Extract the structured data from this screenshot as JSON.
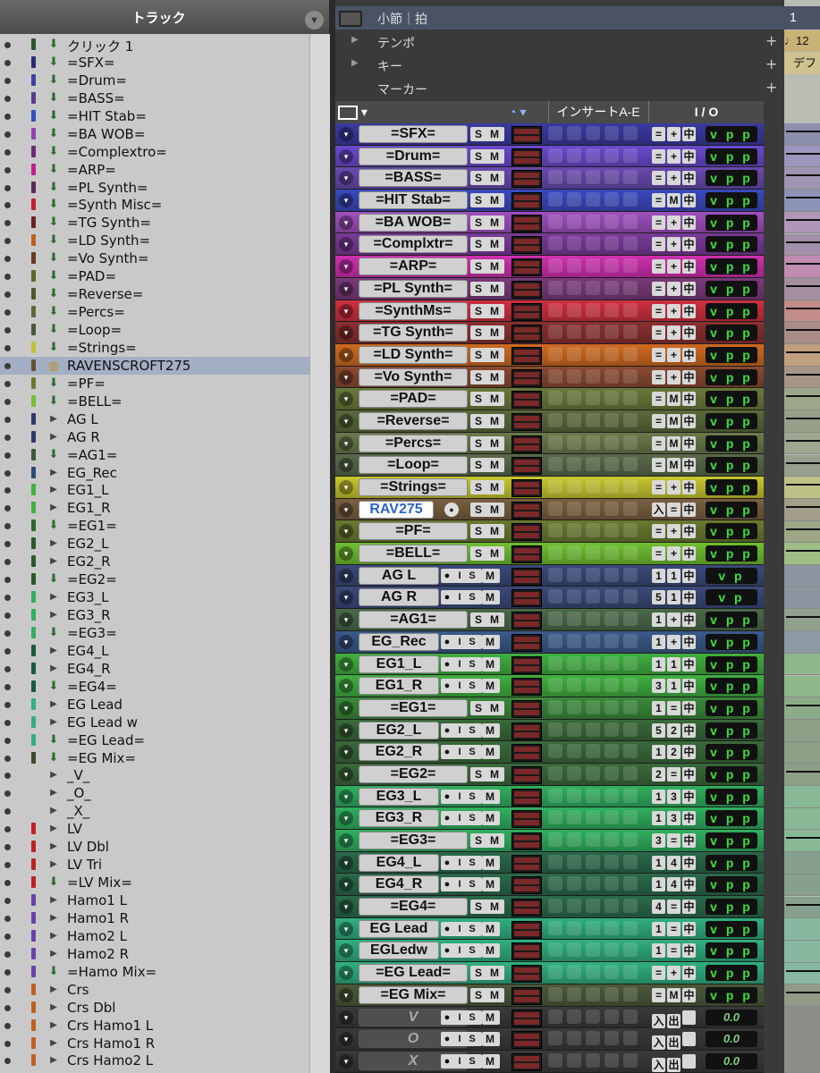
{
  "track_list": {
    "title": "トラック",
    "rows": [
      {
        "name": "クリック 1",
        "color": "#2b5a2b",
        "icon": "arrow",
        "selected": false
      },
      {
        "name": "=SFX=",
        "color": "#2b2b7a",
        "icon": "arrow",
        "selected": false
      },
      {
        "name": "=Drum=",
        "color": "#4040a0",
        "icon": "arrow",
        "selected": false
      },
      {
        "name": "=BASS=",
        "color": "#5a3a8a",
        "icon": "arrow",
        "selected": false
      },
      {
        "name": "=HIT Stab=",
        "color": "#3050c0",
        "icon": "arrow",
        "selected": false
      },
      {
        "name": "=BA WOB=",
        "color": "#9040b0",
        "icon": "arrow",
        "selected": false
      },
      {
        "name": "=Complextro=",
        "color": "#6a2a7a",
        "icon": "arrow",
        "selected": false
      },
      {
        "name": "=ARP=",
        "color": "#c02090",
        "icon": "arrow",
        "selected": false
      },
      {
        "name": "=PL Synth=",
        "color": "#5a2a5a",
        "icon": "arrow",
        "selected": false
      },
      {
        "name": "=Synth Misc=",
        "color": "#c02030",
        "icon": "arrow",
        "selected": false
      },
      {
        "name": "=TG Synth=",
        "color": "#6a2020",
        "icon": "arrow",
        "selected": false
      },
      {
        "name": "=LD Synth=",
        "color": "#c06020",
        "icon": "arrow",
        "selected": false
      },
      {
        "name": "=Vo Synth=",
        "color": "#6a3a20",
        "icon": "arrow",
        "selected": false
      },
      {
        "name": "=PAD=",
        "color": "#5a6a2a",
        "icon": "arrow",
        "selected": false
      },
      {
        "name": "=Reverse=",
        "color": "#4a5a2a",
        "icon": "arrow",
        "selected": false
      },
      {
        "name": "=Percs=",
        "color": "#5a6a3a",
        "icon": "arrow",
        "selected": false
      },
      {
        "name": "=Loop=",
        "color": "#4a5a3a",
        "icon": "arrow",
        "selected": false
      },
      {
        "name": "=Strings=",
        "color": "#c0c030",
        "icon": "arrow",
        "selected": false
      },
      {
        "name": "RAVENSCROFT275",
        "color": "#6a5030",
        "icon": "midi",
        "selected": true
      },
      {
        "name": "=PF=",
        "color": "#6a7a2a",
        "icon": "arrow",
        "selected": false
      },
      {
        "name": "=BELL=",
        "color": "#70c030",
        "icon": "arrow",
        "selected": false
      },
      {
        "name": "AG L",
        "color": "#2a3a6a",
        "icon": "audio",
        "selected": false
      },
      {
        "name": "AG R",
        "color": "#2a3a6a",
        "icon": "audio",
        "selected": false
      },
      {
        "name": "=AG1=",
        "color": "#3a5a3a",
        "icon": "arrow",
        "selected": false
      },
      {
        "name": "EG_Rec",
        "color": "#2a4a7a",
        "icon": "audio",
        "selected": false
      },
      {
        "name": "EG1_L",
        "color": "#40b040",
        "icon": "audio",
        "selected": false
      },
      {
        "name": "EG1_R",
        "color": "#40b040",
        "icon": "audio",
        "selected": false
      },
      {
        "name": "=EG1=",
        "color": "#2a6a2a",
        "icon": "arrow",
        "selected": false
      },
      {
        "name": "EG2_L",
        "color": "#2a5a2a",
        "icon": "audio",
        "selected": false
      },
      {
        "name": "EG2_R",
        "color": "#2a5a2a",
        "icon": "audio",
        "selected": false
      },
      {
        "name": "=EG2=",
        "color": "#2a5a2a",
        "icon": "arrow",
        "selected": false
      },
      {
        "name": "EG3_L",
        "color": "#30b060",
        "icon": "audio",
        "selected": false
      },
      {
        "name": "EG3_R",
        "color": "#30b060",
        "icon": "audio",
        "selected": false
      },
      {
        "name": "=EG3=",
        "color": "#30b060",
        "icon": "arrow",
        "selected": false
      },
      {
        "name": "EG4_L",
        "color": "#1a5a3a",
        "icon": "audio",
        "selected": false
      },
      {
        "name": "EG4_R",
        "color": "#1a5a3a",
        "icon": "audio",
        "selected": false
      },
      {
        "name": "=EG4=",
        "color": "#1a5a3a",
        "icon": "arrow",
        "selected": false
      },
      {
        "name": "EG Lead",
        "color": "#30b080",
        "icon": "audio",
        "selected": false
      },
      {
        "name": "EG Lead w",
        "color": "#30b080",
        "icon": "audio",
        "selected": false
      },
      {
        "name": "=EG Lead=",
        "color": "#30b080",
        "icon": "arrow",
        "selected": false
      },
      {
        "name": "=EG Mix=",
        "color": "#3a4a2a",
        "icon": "arrow",
        "selected": false
      },
      {
        "name": "_V_",
        "color": "",
        "icon": "audio",
        "selected": false
      },
      {
        "name": "_O_",
        "color": "",
        "icon": "audio",
        "selected": false
      },
      {
        "name": "_X_",
        "color": "",
        "icon": "audio",
        "selected": false
      },
      {
        "name": "LV",
        "color": "#c02020",
        "icon": "audio",
        "selected": false
      },
      {
        "name": "LV Dbl",
        "color": "#c02020",
        "icon": "audio",
        "selected": false
      },
      {
        "name": "LV Tri",
        "color": "#c02020",
        "icon": "audio",
        "selected": false
      },
      {
        "name": "=LV Mix=",
        "color": "#c02020",
        "icon": "arrow",
        "selected": false
      },
      {
        "name": "Hamo1 L",
        "color": "#6a40b0",
        "icon": "audio",
        "selected": false
      },
      {
        "name": "Hamo1 R",
        "color": "#6a40b0",
        "icon": "audio",
        "selected": false
      },
      {
        "name": "Hamo2 L",
        "color": "#6a40b0",
        "icon": "audio",
        "selected": false
      },
      {
        "name": "Hamo2 R",
        "color": "#6a40b0",
        "icon": "audio",
        "selected": false
      },
      {
        "name": "=Hamo Mix=",
        "color": "#6a40b0",
        "icon": "arrow",
        "selected": false
      },
      {
        "name": "Crs",
        "color": "#c06020",
        "icon": "audio",
        "selected": false
      },
      {
        "name": "Crs Dbl",
        "color": "#c06020",
        "icon": "audio",
        "selected": false
      },
      {
        "name": "Crs Hamo1 L",
        "color": "#c06020",
        "icon": "audio",
        "selected": false
      },
      {
        "name": "Crs Hamo1 R",
        "color": "#c06020",
        "icon": "audio",
        "selected": false
      },
      {
        "name": "Crs Hamo2 L",
        "color": "#c06020",
        "icon": "audio",
        "selected": false
      }
    ]
  },
  "rulers": {
    "main": "小節｜拍",
    "tempo": "テンポ",
    "key": "キー",
    "marker": "マーカー"
  },
  "timeline": {
    "bar": "1",
    "tempo_value": "♩12",
    "key_value": "デフ"
  },
  "column_header": {
    "inserts": "インサートA-E",
    "io": "I / O"
  },
  "edit_tracks": [
    {
      "name": "=SFX=",
      "color": "#3a3aa0",
      "type": "aux",
      "io": [
        "=",
        "+",
        "中"
      ],
      "out": "v p p"
    },
    {
      "name": "=Drum=",
      "color": "#6a4ad0",
      "type": "aux",
      "io": [
        "=",
        "+",
        "中"
      ],
      "out": "v p p"
    },
    {
      "name": "=BASS=",
      "color": "#6a4ab0",
      "type": "aux",
      "io": [
        "=",
        "+",
        "中"
      ],
      "out": "v p p"
    },
    {
      "name": "=HIT Stab=",
      "color": "#3a4ac0",
      "type": "aux",
      "io": [
        "=",
        "M",
        "中"
      ],
      "out": "v p p"
    },
    {
      "name": "=BA WOB=",
      "color": "#a050c0",
      "type": "aux",
      "io": [
        "=",
        "+",
        "中"
      ],
      "out": "v p p"
    },
    {
      "name": "=Complxtr=",
      "color": "#7a3a9a",
      "type": "aux",
      "io": [
        "=",
        "+",
        "中"
      ],
      "out": "v p p"
    },
    {
      "name": "=ARP=",
      "color": "#d030b0",
      "type": "aux",
      "io": [
        "=",
        "+",
        "中"
      ],
      "out": "v p p"
    },
    {
      "name": "=PL Synth=",
      "color": "#7a3a7a",
      "type": "aux",
      "io": [
        "=",
        "+",
        "中"
      ],
      "out": "v p p"
    },
    {
      "name": "=SynthMs=",
      "color": "#d03040",
      "type": "aux",
      "io": [
        "=",
        "+",
        "中"
      ],
      "out": "v p p"
    },
    {
      "name": "=TG Synth=",
      "color": "#8a3030",
      "type": "aux",
      "io": [
        "=",
        "+",
        "中"
      ],
      "out": "v p p"
    },
    {
      "name": "=LD Synth=",
      "color": "#d06a20",
      "type": "aux",
      "io": [
        "=",
        "+",
        "中"
      ],
      "out": "v p p"
    },
    {
      "name": "=Vo Synth=",
      "color": "#8a4a30",
      "type": "aux",
      "io": [
        "=",
        "+",
        "中"
      ],
      "out": "v p p"
    },
    {
      "name": "=PAD=",
      "color": "#6a7a3a",
      "type": "aux",
      "io": [
        "=",
        "M",
        "中"
      ],
      "out": "v p p"
    },
    {
      "name": "=Reverse=",
      "color": "#5a6a3a",
      "type": "aux",
      "io": [
        "=",
        "M",
        "中"
      ],
      "out": "v p p"
    },
    {
      "name": "=Percs=",
      "color": "#6a7a4a",
      "type": "aux",
      "io": [
        "=",
        "M",
        "中"
      ],
      "out": "v p p"
    },
    {
      "name": "=Loop=",
      "color": "#5a6a4a",
      "type": "aux",
      "io": [
        "=",
        "M",
        "中"
      ],
      "out": "v p p"
    },
    {
      "name": "=Strings=",
      "color": "#c8c830",
      "type": "aux",
      "io": [
        "=",
        "+",
        "中"
      ],
      "out": "v p p"
    },
    {
      "name": "RAV275",
      "color": "#7a6040",
      "type": "inst",
      "io": [
        "入",
        "=",
        "中"
      ],
      "out": "v p p"
    },
    {
      "name": "=PF=",
      "color": "#6a7a30",
      "type": "aux",
      "io": [
        "=",
        "+",
        "中"
      ],
      "out": "v p p"
    },
    {
      "name": "=BELL=",
      "color": "#70c030",
      "type": "aux",
      "io": [
        "=",
        "+",
        "中"
      ],
      "out": "v p p"
    },
    {
      "name": "AG L",
      "color": "#3a4a7a",
      "type": "audio",
      "io": [
        "1",
        "1",
        "中"
      ],
      "out": "v p"
    },
    {
      "name": "AG R",
      "color": "#3a4a7a",
      "type": "audio",
      "io": [
        "5",
        "1",
        "中"
      ],
      "out": "v p"
    },
    {
      "name": "=AG1=",
      "color": "#4a6a4a",
      "type": "aux",
      "io": [
        "1",
        "+",
        "中"
      ],
      "out": "v p p"
    },
    {
      "name": "EG_Rec",
      "color": "#3a5a8a",
      "type": "audio",
      "io": [
        "1",
        "+",
        "中"
      ],
      "out": "v p p"
    },
    {
      "name": "EG1_L",
      "color": "#40b040",
      "type": "audio",
      "io": [
        "1",
        "1",
        "中"
      ],
      "out": "v p p"
    },
    {
      "name": "EG1_R",
      "color": "#40b040",
      "type": "audio",
      "io": [
        "3",
        "1",
        "中"
      ],
      "out": "v p p"
    },
    {
      "name": "=EG1=",
      "color": "#3a8a3a",
      "type": "aux",
      "io": [
        "1",
        "=",
        "中"
      ],
      "out": "v p p"
    },
    {
      "name": "EG2_L",
      "color": "#3a6a3a",
      "type": "audio",
      "io": [
        "5",
        "2",
        "中"
      ],
      "out": "v p p"
    },
    {
      "name": "EG2_R",
      "color": "#3a6a3a",
      "type": "audio",
      "io": [
        "1",
        "2",
        "中"
      ],
      "out": "v p p"
    },
    {
      "name": "=EG2=",
      "color": "#3a6a3a",
      "type": "aux",
      "io": [
        "2",
        "=",
        "中"
      ],
      "out": "v p p"
    },
    {
      "name": "EG3_L",
      "color": "#30b060",
      "type": "audio",
      "io": [
        "1",
        "3",
        "中"
      ],
      "out": "v p p"
    },
    {
      "name": "EG3_R",
      "color": "#30b060",
      "type": "audio",
      "io": [
        "1",
        "3",
        "中"
      ],
      "out": "v p p"
    },
    {
      "name": "=EG3=",
      "color": "#30b060",
      "type": "aux",
      "io": [
        "3",
        "=",
        "中"
      ],
      "out": "v p p"
    },
    {
      "name": "EG4_L",
      "color": "#2a6a4a",
      "type": "audio",
      "io": [
        "1",
        "4",
        "中"
      ],
      "out": "v p p"
    },
    {
      "name": "EG4_R",
      "color": "#2a6a4a",
      "type": "audio",
      "io": [
        "1",
        "4",
        "中"
      ],
      "out": "v p p"
    },
    {
      "name": "=EG4=",
      "color": "#2a6a4a",
      "type": "aux",
      "io": [
        "4",
        "=",
        "中"
      ],
      "out": "v p p"
    },
    {
      "name": "EG Lead",
      "color": "#30b080",
      "type": "audio",
      "io": [
        "1",
        "=",
        "中"
      ],
      "out": "v p p"
    },
    {
      "name": "EGLedw",
      "color": "#30b080",
      "type": "audio",
      "io": [
        "1",
        "=",
        "中"
      ],
      "out": "v p p"
    },
    {
      "name": "=EG Lead=",
      "color": "#30b080",
      "type": "aux",
      "io": [
        "=",
        "+",
        "中"
      ],
      "out": "v p p"
    },
    {
      "name": "=EG Mix=",
      "color": "#4a5a3a",
      "type": "aux",
      "io": [
        "=",
        "M",
        "中"
      ],
      "out": "v p p"
    },
    {
      "name": "V",
      "color": "#3a3a3a",
      "type": "inactive",
      "io": [
        "入",
        "出",
        ""
      ],
      "out": "0.0"
    },
    {
      "name": "O",
      "color": "#3a3a3a",
      "type": "inactive",
      "io": [
        "入",
        "出",
        ""
      ],
      "out": "0.0"
    },
    {
      "name": "X",
      "color": "#3a3a3a",
      "type": "inactive",
      "io": [
        "入",
        "出",
        ""
      ],
      "out": "0.0"
    }
  ]
}
